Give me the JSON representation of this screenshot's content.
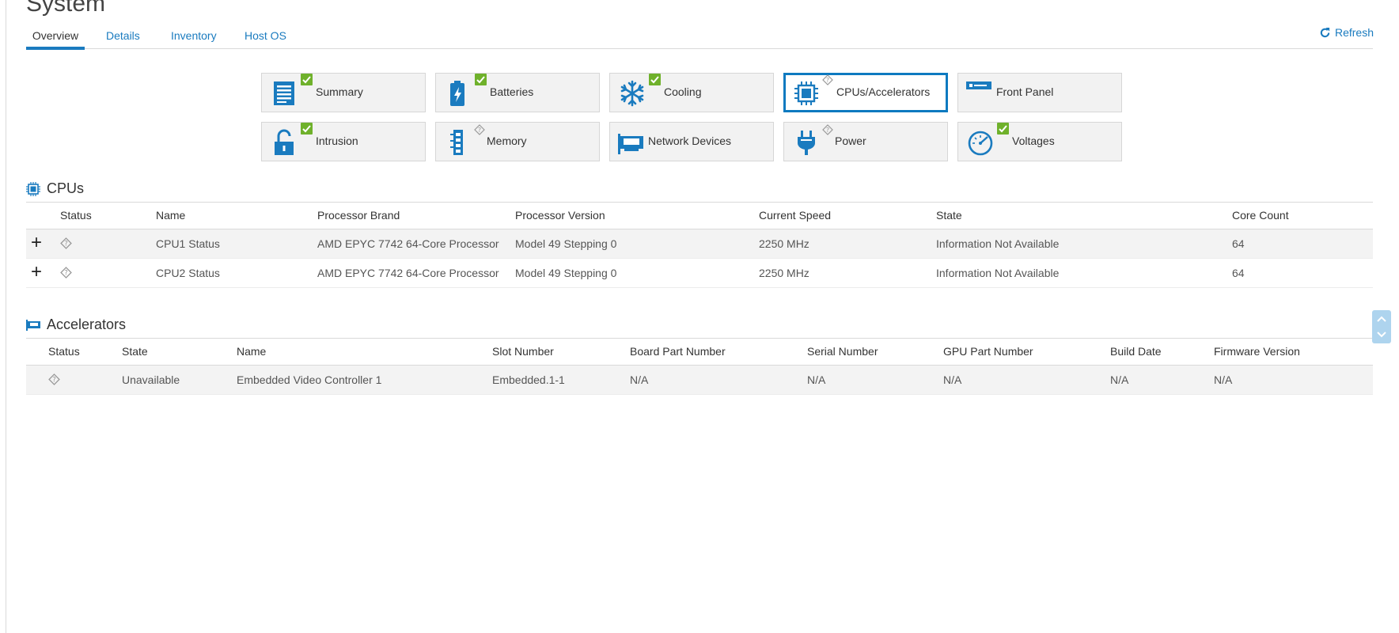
{
  "page": {
    "title": "System"
  },
  "tabs": [
    {
      "label": "Overview",
      "active": true
    },
    {
      "label": "Details",
      "active": false
    },
    {
      "label": "Inventory",
      "active": false
    },
    {
      "label": "Host OS",
      "active": false
    }
  ],
  "refresh_label": "Refresh",
  "tiles": [
    {
      "label": "Summary",
      "status": "ok",
      "icon": "list-icon"
    },
    {
      "label": "Batteries",
      "status": "ok",
      "icon": "battery-icon"
    },
    {
      "label": "Cooling",
      "status": "ok",
      "icon": "snowflake-icon"
    },
    {
      "label": "CPUs/Accelerators",
      "status": "unknown",
      "icon": "cpu-chip-icon",
      "selected": true
    },
    {
      "label": "Front Panel",
      "status": "none",
      "icon": "front-panel-icon"
    },
    {
      "label": "Intrusion",
      "status": "ok",
      "icon": "unlock-icon"
    },
    {
      "label": "Memory",
      "status": "unknown",
      "icon": "memory-module-icon"
    },
    {
      "label": "Network Devices",
      "status": "none",
      "icon": "network-card-icon"
    },
    {
      "label": "Power",
      "status": "unknown",
      "icon": "power-plug-icon"
    },
    {
      "label": "Voltages",
      "status": "ok",
      "icon": "gauge-icon"
    }
  ],
  "cpus": {
    "title": "CPUs",
    "columns": [
      "Status",
      "Name",
      "Processor Brand",
      "Processor Version",
      "Current Speed",
      "State",
      "Core Count"
    ],
    "rows": [
      {
        "name": "CPU1 Status",
        "brand": "AMD EPYC 7742 64-Core Processor",
        "version": "Model 49 Stepping 0",
        "speed": "2250 MHz",
        "state": "Information Not Available",
        "cores": "64"
      },
      {
        "name": "CPU2 Status",
        "brand": "AMD EPYC 7742 64-Core Processor",
        "version": "Model 49 Stepping 0",
        "speed": "2250 MHz",
        "state": "Information Not Available",
        "cores": "64"
      }
    ]
  },
  "accelerators": {
    "title": "Accelerators",
    "columns": [
      "Status",
      "State",
      "Name",
      "Slot Number",
      "Board Part Number",
      "Serial Number",
      "GPU Part Number",
      "Build Date",
      "Firmware Version"
    ],
    "rows": [
      {
        "state": "Unavailable",
        "name": "Embedded Video Controller 1",
        "slot": "Embedded.1-1",
        "board_part": "N/A",
        "serial": "N/A",
        "gpu_part": "N/A",
        "build_date": "N/A",
        "firmware": "N/A"
      }
    ]
  },
  "colors": {
    "accent": "#1a7bbf",
    "ok": "#6fb12b",
    "tile_bg": "#f2f2f2"
  }
}
